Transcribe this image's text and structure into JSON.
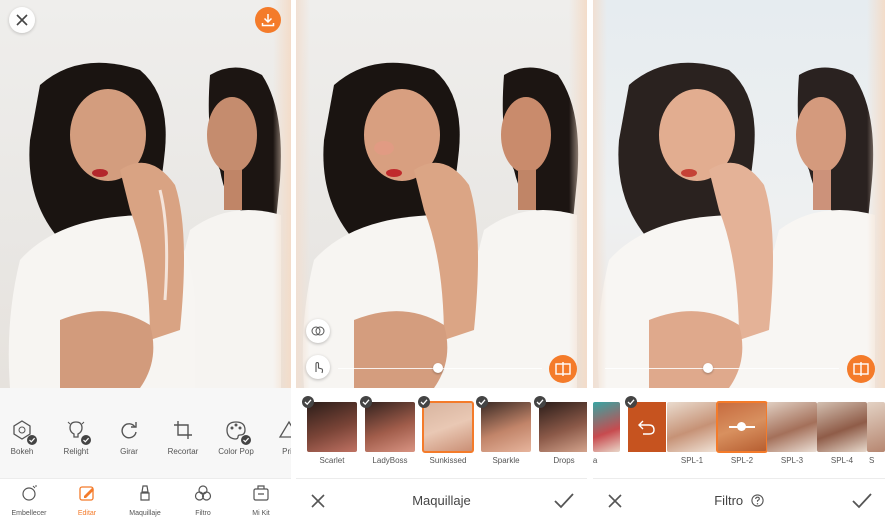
{
  "brand_color": "#f47b2a",
  "panel1": {
    "close_icon": "close-icon",
    "download_icon": "download-icon",
    "tools": [
      {
        "label": "Bokeh",
        "icon": "bokeh-icon"
      },
      {
        "label": "Relight",
        "icon": "relight-icon"
      },
      {
        "label": "Girar",
        "icon": "rotate-icon"
      },
      {
        "label": "Recortar",
        "icon": "crop-icon"
      },
      {
        "label": "Color Pop",
        "icon": "color-pop-icon"
      },
      {
        "label": "Pris",
        "icon": "prism-icon"
      }
    ],
    "nav": [
      {
        "label": "Embellecer",
        "icon": "retouch-icon"
      },
      {
        "label": "Editar",
        "icon": "edit-icon"
      },
      {
        "label": "Maquillaje",
        "icon": "makeup-icon"
      },
      {
        "label": "Filtro",
        "icon": "filter-icon"
      },
      {
        "label": "Mi Kit",
        "icon": "kit-icon"
      }
    ],
    "active_nav": "Editar"
  },
  "panel2": {
    "title": "Maquillaje",
    "slider_value": 0.49,
    "looks": [
      "Scarlet",
      "LadyBoss",
      "Sunkissed",
      "Sparkle",
      "Drops"
    ],
    "selected": "Sunkissed"
  },
  "panel3": {
    "title": "Filtro",
    "slider_value": 0.44,
    "filters": [
      "ola",
      "SPL-1",
      "SPL-2",
      "SPL-3",
      "SPL-4",
      "S"
    ],
    "selected": "SPL-2"
  }
}
